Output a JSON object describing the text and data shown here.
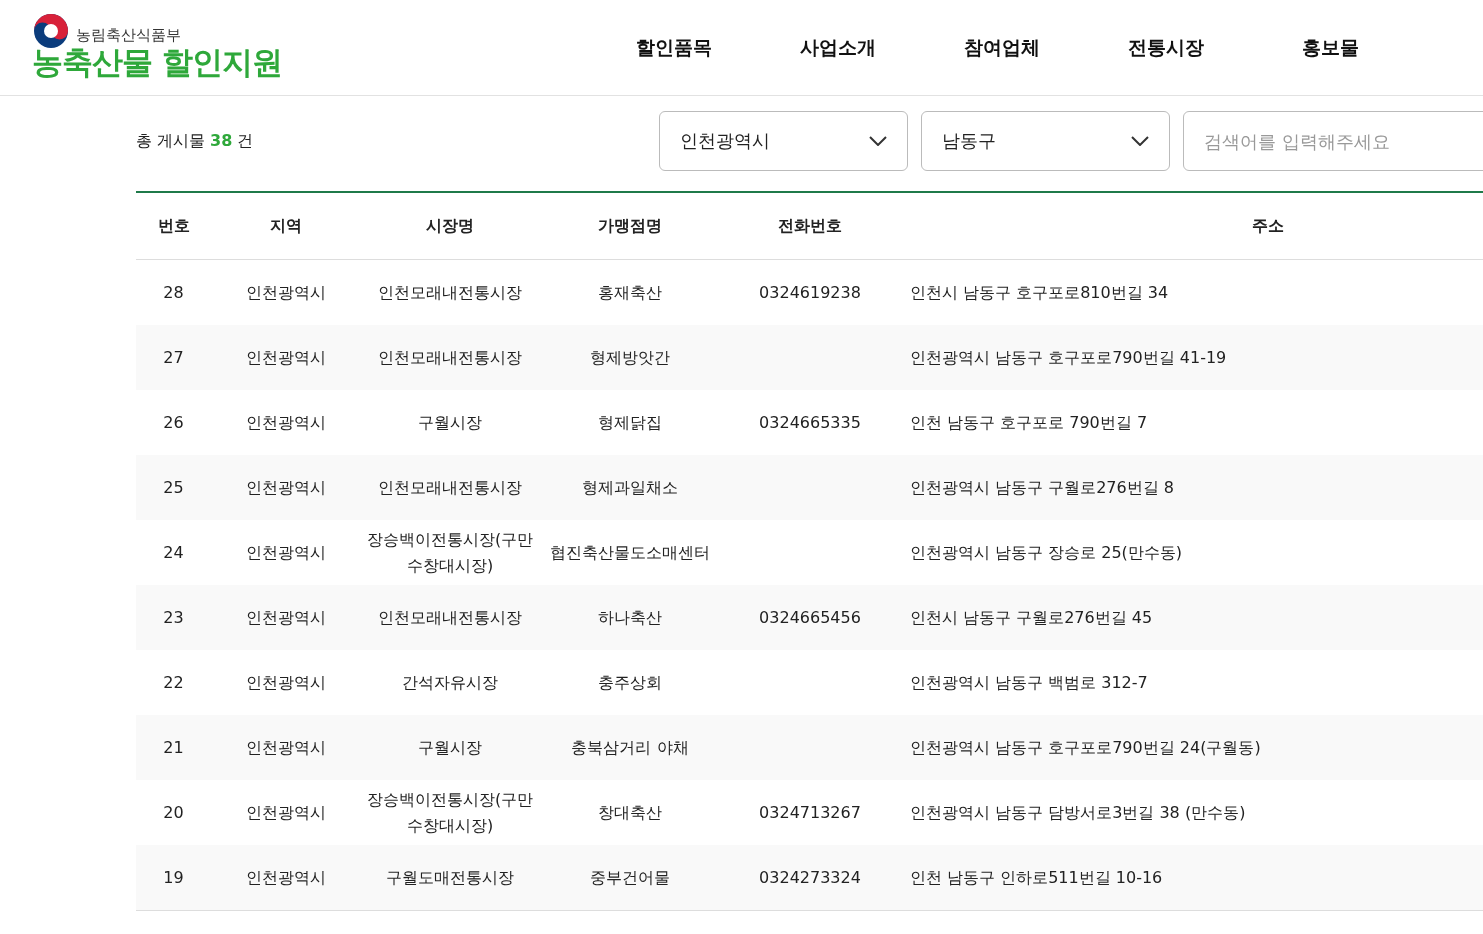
{
  "header": {
    "ministry": "농림축산식품부",
    "title": "농축산물 할인지원",
    "nav": [
      {
        "label": "할인품목"
      },
      {
        "label": "사업소개"
      },
      {
        "label": "참여업체"
      },
      {
        "label": "전통시장"
      },
      {
        "label": "홍보물"
      }
    ]
  },
  "toolbar": {
    "total_prefix": "총 게시물",
    "total_count": "38",
    "total_suffix": "건",
    "filters": [
      {
        "value": "인천광역시"
      },
      {
        "value": "남동구"
      }
    ],
    "search": {
      "placeholder": "검색어를 입력해주세요"
    }
  },
  "table": {
    "columns": [
      "번호",
      "지역",
      "시장명",
      "가맹점명",
      "전화번호",
      "주소"
    ],
    "rows": [
      [
        "28",
        "인천광역시",
        "인천모래내전통시장",
        "홍재축산",
        "0324619238",
        "인천시 남동구 호구포로810번길 34"
      ],
      [
        "27",
        "인천광역시",
        "인천모래내전통시장",
        "형제방앗간",
        "",
        "인천광역시 남동구 호구포로790번길 41-19"
      ],
      [
        "26",
        "인천광역시",
        "구월시장",
        "형제닭집",
        "0324665335",
        "인천 남동구 호구포로 790번길 7"
      ],
      [
        "25",
        "인천광역시",
        "인천모래내전통시장",
        "형제과일채소",
        "",
        "인천광역시 남동구 구월로276번길 8"
      ],
      [
        "24",
        "인천광역시",
        "장승백이전통시장(구만수창대시장)",
        "협진축산물도소매센터",
        "",
        "인천광역시 남동구 장승로 25(만수동)"
      ],
      [
        "23",
        "인천광역시",
        "인천모래내전통시장",
        "하나축산",
        "0324665456",
        "인천시 남동구 구월로276번길 45"
      ],
      [
        "22",
        "인천광역시",
        "간석자유시장",
        "충주상회",
        "",
        "인천광역시 남동구 백범로 312-7"
      ],
      [
        "21",
        "인천광역시",
        "구월시장",
        "충북삼거리 야채",
        "",
        "인천광역시 남동구 호구포로790번길 24(구월동)"
      ],
      [
        "20",
        "인천광역시",
        "장승백이전통시장(구만수창대시장)",
        "창대축산",
        "0324713267",
        "인천광역시 남동구 담방서로3번길 38 (만수동)"
      ],
      [
        "19",
        "인천광역시",
        "구월도매전통시장",
        "중부건어물",
        "0324273324",
        "인천 남동구 인하로511번길 10-16"
      ]
    ]
  }
}
